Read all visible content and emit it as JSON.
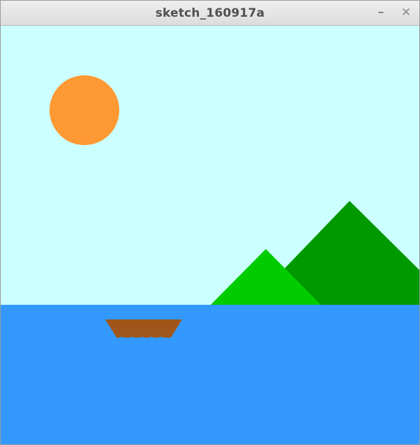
{
  "window": {
    "title": "sketch_160917a",
    "minimize_glyph": "–",
    "close_glyph": "✕"
  },
  "scene": {
    "sky_color": "#ccffff",
    "sea_color": "#3399ff",
    "sun_color": "#ff9933",
    "mountain_back_color": "#009900",
    "mountain_front_color": "#00cc00",
    "boat_color": "#a0561a"
  }
}
